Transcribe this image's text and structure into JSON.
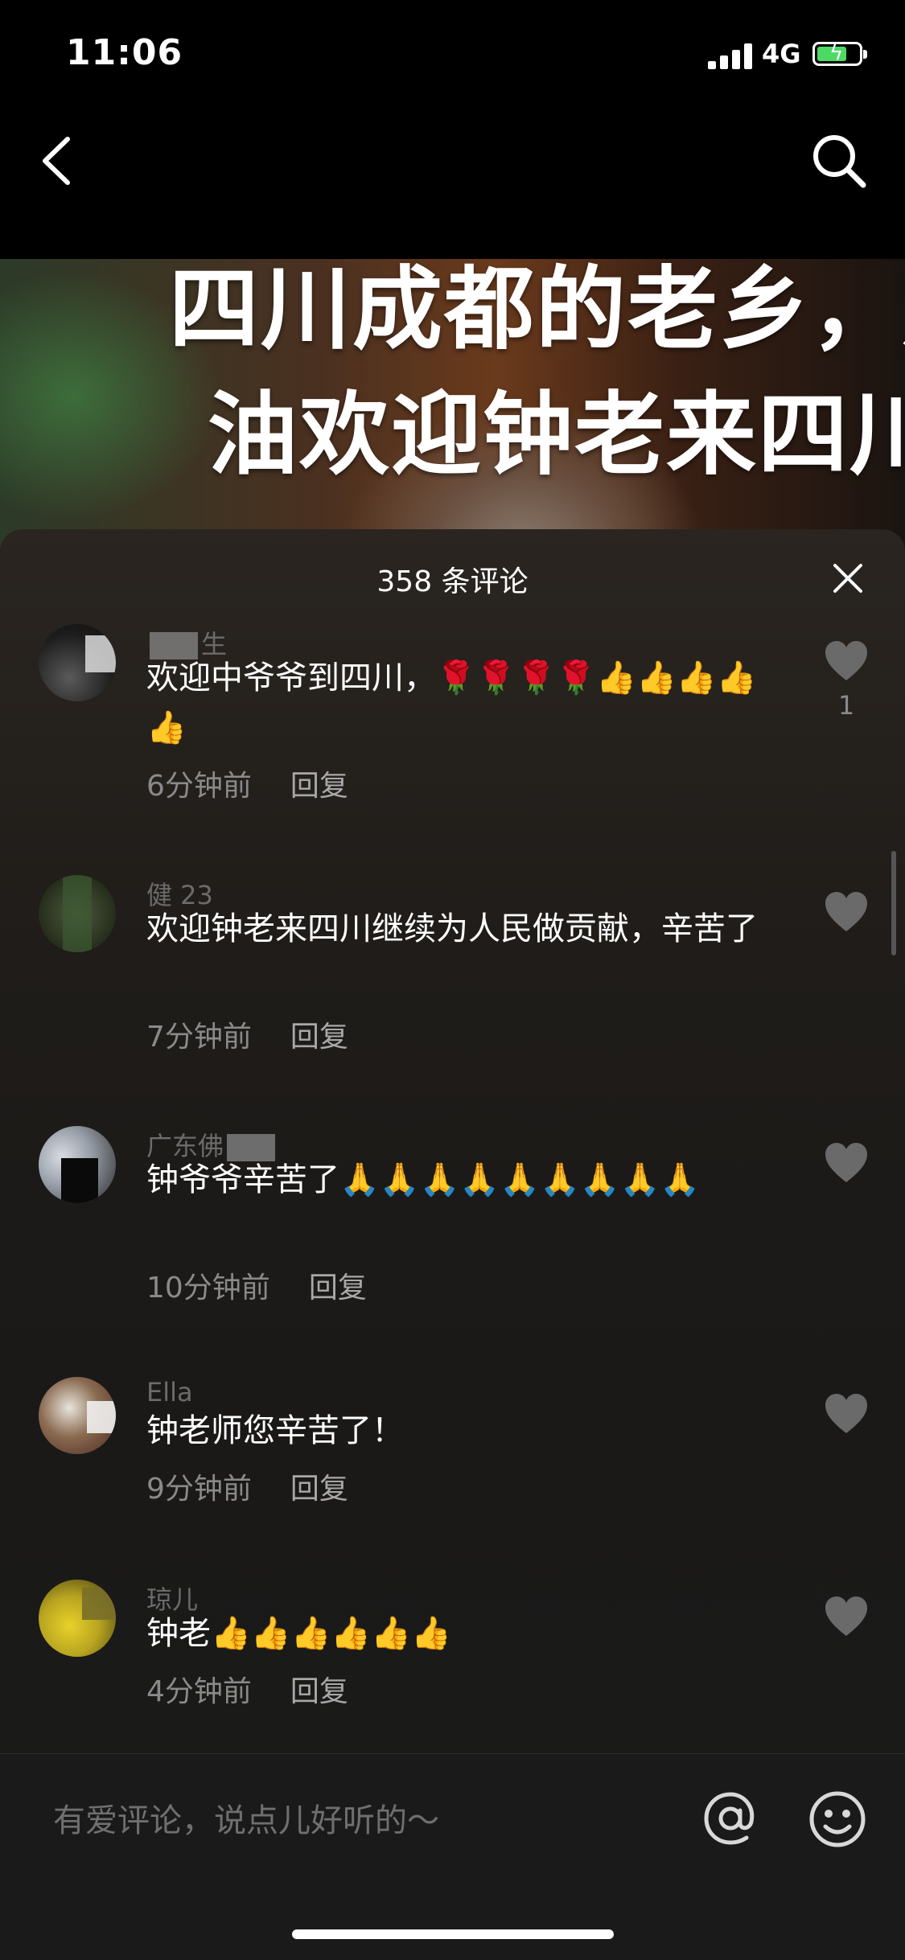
{
  "status_bar": {
    "time": "11:06",
    "network": "4G",
    "battery_level": 0.6
  },
  "video": {
    "overlay_line1": "四川成都的老乡，加",
    "overlay_line2": "油欢迎钟老来四川"
  },
  "comments_panel": {
    "title": "358 条评论",
    "reply_label": "回复",
    "comments": [
      {
        "username": "生",
        "text": "欢迎中爷爷到四川，🌹🌹🌹🌹👍👍👍👍👍",
        "time": "6分钟前",
        "likes": "1"
      },
      {
        "username": "健 23",
        "text": "欢迎钟老来四川继续为人民做贡献，辛苦了",
        "time": "7分钟前",
        "likes": ""
      },
      {
        "username": "广东佛",
        "text": "钟爷爷辛苦了🙏🙏🙏🙏🙏🙏🙏🙏🙏",
        "time": "10分钟前",
        "likes": ""
      },
      {
        "username": "Ella",
        "text": "钟老师您辛苦了！",
        "time": "9分钟前",
        "likes": ""
      },
      {
        "username": "琼儿",
        "text": "钟老👍👍👍👍👍👍",
        "time": "4分钟前",
        "likes": ""
      }
    ]
  },
  "input": {
    "placeholder": "有爱评论，说点儿好听的～"
  },
  "icons": {
    "back": "chevron-left-icon",
    "search": "search-icon",
    "close": "close-icon",
    "like": "heart-icon",
    "at": "at-sign-icon",
    "emoji": "smiley-icon"
  },
  "colors": {
    "accent_battery": "#4cd964",
    "meta_text": "#8a8a8a",
    "username_text": "#6b6b6b"
  }
}
